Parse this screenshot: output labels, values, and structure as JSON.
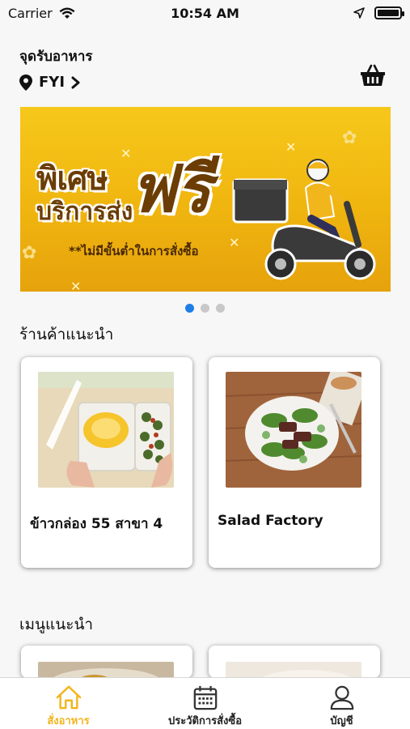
{
  "status_bar": {
    "carrier": "Carrier",
    "time": "10:54 AM"
  },
  "header": {
    "pickup_label": "จุดรับอาหาร",
    "location": "FYI"
  },
  "banner": {
    "line1": "พิเศษ",
    "line2": "บริการส่ง",
    "highlight": "ฟรี",
    "note": "**ไม่มีขั้นต่ำในการสั่งซื้อ",
    "page_count": 3,
    "active_page": 1
  },
  "recommended_shops": {
    "title": "ร้านค้าแนะนำ",
    "items": [
      {
        "name": "ข้าวกล่อง 55 สาขา 4"
      },
      {
        "name": "Salad Factory"
      }
    ]
  },
  "recommended_menu": {
    "title": "เมนูแนะนำ"
  },
  "tab_bar": {
    "tabs": [
      {
        "label": "สั่งอาหาร",
        "icon": "home-icon",
        "active": true
      },
      {
        "label": "ประวัติการสั่งซื้อ",
        "icon": "calendar-icon",
        "active": false
      },
      {
        "label": "บัญชี",
        "icon": "user-icon",
        "active": false
      }
    ]
  },
  "colors": {
    "accent": "#f2b61d",
    "dot_active": "#1e7ee6",
    "banner": "#f6c81b"
  }
}
